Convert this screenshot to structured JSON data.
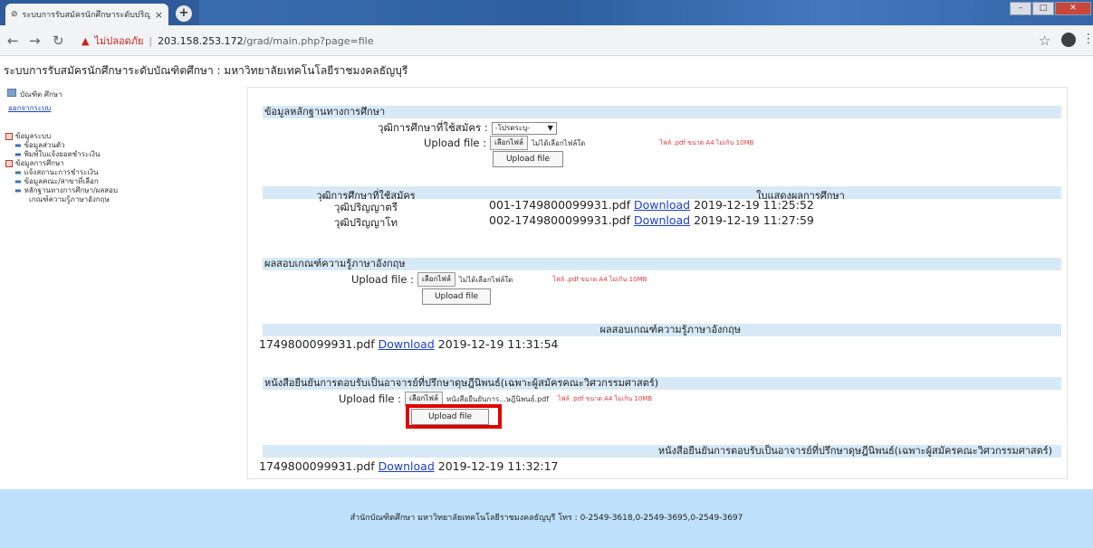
{
  "browser": {
    "tab_title": "ระบบการรับสมัครนักศึกษาระดับปริญญ",
    "tab_close": "×",
    "new_tab": "+",
    "insecure_label": "ไม่ปลอดภัย",
    "url_host": "203.158.253.172",
    "url_path": "/grad/main.php?page=file"
  },
  "page_header": "ระบบการรับสมัครนักศึกษาระดับบัณฑิตศึกษา : มหาวิทยาลัยเทคโนโลยีราชมงคลธัญบุรี",
  "sidebar": {
    "user_name": "บัณฑิต ศึกษา",
    "logout": "ออกจากระบบ",
    "groups": [
      {
        "label": "ข้อมูลระบบ",
        "items": [
          "ข้อมูลส่วนตัว",
          "พิมพ์ใบแจ้งยอดชำระเงิน"
        ]
      },
      {
        "label": "ข้อมูลการศึกษา",
        "items": [
          "แจ้งสถานะการชำระเงิน",
          "ข้อมูลคณะ/สาขาที่เลือก",
          "หลักฐานทางการศึกษา/ผลสอบ",
          "เกณฑ์ความรู้ภาษาอังกฤษ"
        ]
      }
    ]
  },
  "sections": {
    "education": {
      "title": "ข้อมูลหลักฐานทางการศึกษา",
      "degree_label": "วุฒิการศึกษาที่ใช้สมัคร :",
      "degree_select": "-โปรดระบุ-",
      "upload_label": "Upload file :",
      "choose_file": "เลือกไฟล์",
      "no_file": "ไม่ได้เลือกไฟล์ใด",
      "note": "ไฟล์ .pdf ขนาด A4 ไม่เกิน 10MB",
      "upload_button": "Upload file",
      "table_headers": [
        "วุฒิการศึกษาที่ใช้สมัคร",
        "ใบแสดงผลการศึกษา"
      ],
      "rows": [
        {
          "degree": "วุฒิปริญญาตรี",
          "file": "001-1749800099931.pdf",
          "link": "Download",
          "date": "2019-12-19 11:25:52"
        },
        {
          "degree": "วุฒิปริญญาโท",
          "file": "002-1749800099931.pdf",
          "link": "Download",
          "date": "2019-12-19 11:27:59"
        }
      ]
    },
    "english": {
      "title": "ผลสอบเกณฑ์ความรู้ภาษาอังกฤษ",
      "upload_label": "Upload file :",
      "choose_file": "เลือกไฟล์",
      "no_file": "ไม่ได้เลือกไฟล์ใด",
      "note": "ไฟล์ .pdf ขนาด A4 ไม่เกิน 10MB",
      "upload_button": "Upload file",
      "result_header": "ผลสอบเกณฑ์ความรู้ภาษาอังกฤษ",
      "row": {
        "file": "1749800099931.pdf",
        "link": "Download",
        "date": "2019-12-19 11:31:54"
      }
    },
    "advisor": {
      "title": "หนังสือยืนยันการตอบรับเป็นอาจารย์ที่ปรึกษาดุษฎีนิพนธ์(เฉพาะผู้สมัครคณะวิศวกรรมศาสตร์)",
      "upload_label": "Upload file :",
      "choose_file": "เลือกไฟล์",
      "selected_file": "หนังสือยืนยันการ...ษฎีนิพนธ์.pdf",
      "note": "ไฟล์ .pdf ขนาด A4 ไม่เกิน 10MB",
      "upload_button": "Upload file",
      "result_header": "หนังสือยืนยันการตอบรับเป็นอาจารย์ที่ปรึกษาดุษฎีนิพนธ์(เฉพาะผู้สมัครคณะวิศวกรรมศาสตร์)",
      "row": {
        "file": "1749800099931.pdf",
        "link": "Download",
        "date": "2019-12-19 11:32:17"
      }
    }
  },
  "footer": "สำนักบัณฑิตศึกษา มหาวิทยาลัยเทคโนโลยีราชมงคลธัญบุรี โทร : 0-2549-3618,0-2549-3695,0-2549-3697"
}
